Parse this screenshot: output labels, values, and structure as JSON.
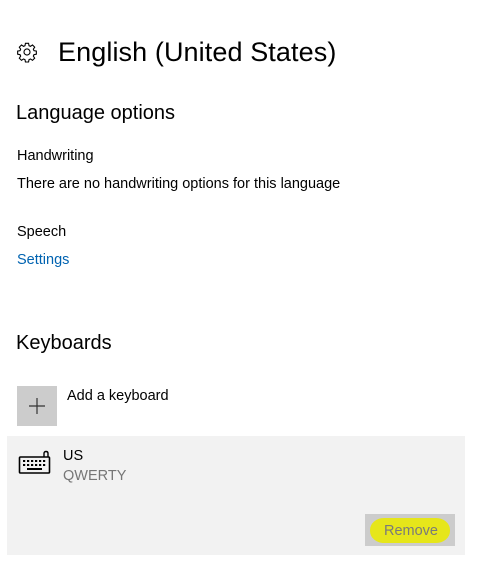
{
  "header": {
    "title": "English (United States)",
    "icon": "gear-icon"
  },
  "language_options": {
    "title": "Language options",
    "handwriting": {
      "label": "Handwriting",
      "description": "There are no handwriting options for this language"
    },
    "speech": {
      "label": "Speech",
      "settings_link": "Settings"
    }
  },
  "keyboards": {
    "title": "Keyboards",
    "add_label": "Add a keyboard",
    "items": [
      {
        "name": "US",
        "layout": "QWERTY",
        "remove_label": "Remove"
      }
    ]
  },
  "colors": {
    "link": "#0063b1",
    "selected_item_bg": "#f2f2f2",
    "button_bg": "#cccccc",
    "highlight": "#e6e61a"
  }
}
